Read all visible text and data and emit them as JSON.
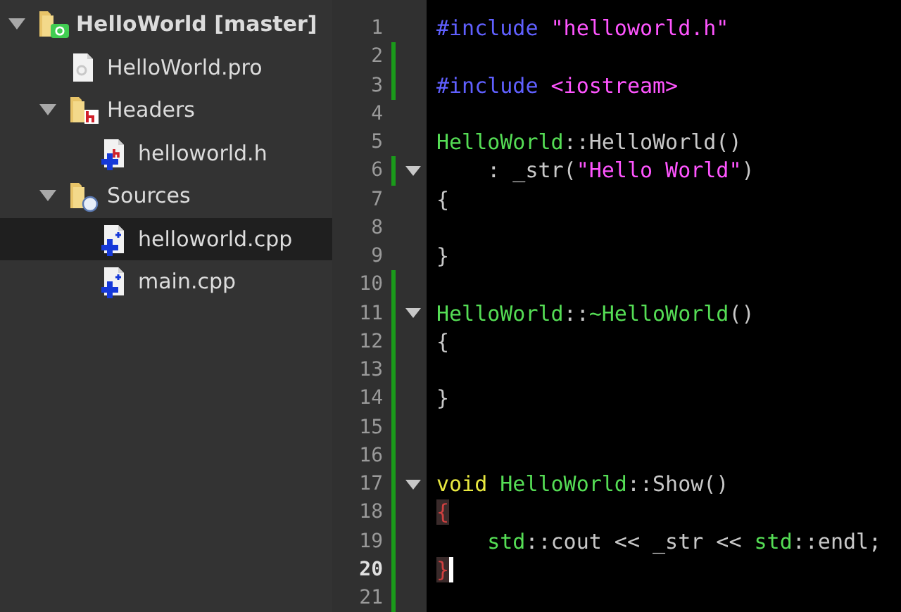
{
  "project_tree": [
    {
      "label": "HelloWorld [master]",
      "kind": "project",
      "expanded": true,
      "selected": false,
      "children": [
        {
          "label": "HelloWorld.pro",
          "kind": "pro-file",
          "selected": false
        },
        {
          "label": "Headers",
          "kind": "header-folder",
          "expanded": true,
          "selected": false,
          "children": [
            {
              "label": "helloworld.h",
              "kind": "header-file",
              "selected": false
            }
          ]
        },
        {
          "label": "Sources",
          "kind": "source-folder",
          "expanded": true,
          "selected": false,
          "children": [
            {
              "label": "helloworld.cpp",
              "kind": "source-file",
              "selected": true
            },
            {
              "label": "main.cpp",
              "kind": "source-file",
              "selected": false
            }
          ]
        }
      ]
    }
  ],
  "editor": {
    "lines": [
      {
        "number": "1",
        "changed": false,
        "foldable": false,
        "current": false,
        "tokens": [
          {
            "kind": "preprocessor",
            "text": "#include"
          },
          {
            "kind": "string",
            "text": " \"helloworld.h\""
          }
        ]
      },
      {
        "number": "2",
        "changed": true,
        "foldable": false,
        "current": false
      },
      {
        "number": "3",
        "changed": true,
        "foldable": false,
        "current": false,
        "tokens": [
          {
            "kind": "preprocessor",
            "text": "#include"
          },
          {
            "kind": "string",
            "text": " <iostream>"
          }
        ]
      },
      {
        "number": "4",
        "changed": false,
        "foldable": false,
        "current": false
      },
      {
        "number": "5",
        "changed": false,
        "foldable": false,
        "current": false,
        "tokens": [
          {
            "kind": "type",
            "text": "HelloWorld"
          },
          {
            "kind": "plain",
            "text": "::HelloWorld()"
          }
        ]
      },
      {
        "number": "6",
        "changed": true,
        "foldable": true,
        "current": false,
        "tokens": [
          {
            "kind": "plain",
            "text": "    : _str("
          },
          {
            "kind": "string",
            "text": "\"Hello World\""
          },
          {
            "kind": "plain",
            "text": ")"
          }
        ]
      },
      {
        "number": "7",
        "changed": false,
        "foldable": false,
        "current": false,
        "tokens": [
          {
            "kind": "plain",
            "text": "{"
          }
        ]
      },
      {
        "number": "8",
        "changed": false,
        "foldable": false,
        "current": false
      },
      {
        "number": "9",
        "changed": false,
        "foldable": false,
        "current": false,
        "tokens": [
          {
            "kind": "plain",
            "text": "}"
          }
        ]
      },
      {
        "number": "10",
        "changed": true,
        "foldable": false,
        "current": false
      },
      {
        "number": "11",
        "changed": true,
        "foldable": true,
        "current": false,
        "tokens": [
          {
            "kind": "type",
            "text": "HelloWorld"
          },
          {
            "kind": "plain",
            "text": "::"
          },
          {
            "kind": "type",
            "text": "~HelloWorld"
          },
          {
            "kind": "plain",
            "text": "()"
          }
        ]
      },
      {
        "number": "12",
        "changed": true,
        "foldable": false,
        "current": false,
        "tokens": [
          {
            "kind": "plain",
            "text": "{"
          }
        ]
      },
      {
        "number": "13",
        "changed": true,
        "foldable": false,
        "current": false
      },
      {
        "number": "14",
        "changed": true,
        "foldable": false,
        "current": false,
        "tokens": [
          {
            "kind": "plain",
            "text": "}"
          }
        ]
      },
      {
        "number": "15",
        "changed": true,
        "foldable": false,
        "current": false
      },
      {
        "number": "16",
        "changed": true,
        "foldable": false,
        "current": false
      },
      {
        "number": "17",
        "changed": true,
        "foldable": true,
        "current": false,
        "tokens": [
          {
            "kind": "keyword",
            "text": "void"
          },
          {
            "kind": "type",
            "text": " HelloWorld"
          },
          {
            "kind": "plain",
            "text": "::Show()"
          }
        ]
      },
      {
        "number": "18",
        "changed": true,
        "foldable": false,
        "current": false,
        "tokens": [
          {
            "kind": "brace-match",
            "text": "{"
          }
        ]
      },
      {
        "number": "19",
        "changed": true,
        "foldable": false,
        "current": false,
        "tokens": [
          {
            "kind": "type",
            "text": "    std"
          },
          {
            "kind": "plain",
            "text": "::cout << _str << "
          },
          {
            "kind": "type",
            "text": "std"
          },
          {
            "kind": "plain",
            "text": "::endl;"
          }
        ]
      },
      {
        "number": "20",
        "changed": true,
        "foldable": false,
        "current": true,
        "tokens": [
          {
            "kind": "brace-match",
            "text": "}"
          }
        ]
      },
      {
        "number": "21",
        "changed": true,
        "foldable": false,
        "current": false
      }
    ]
  }
}
